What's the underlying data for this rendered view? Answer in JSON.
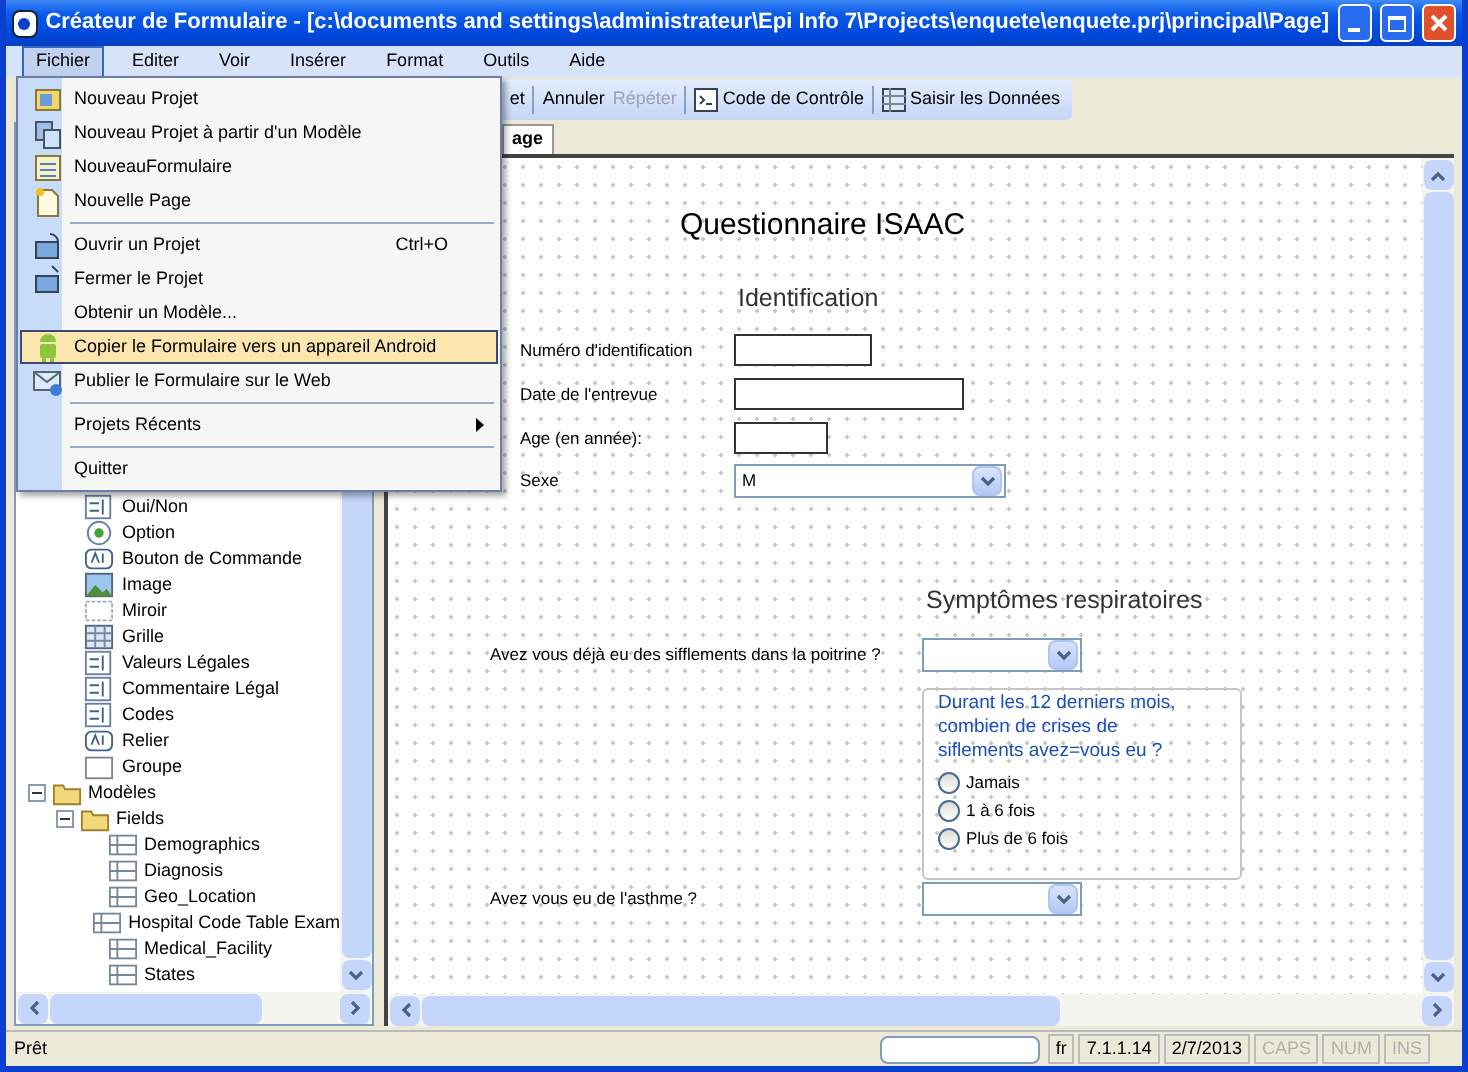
{
  "window": {
    "title": "Créateur de Formulaire - [c:\\documents and settings\\administrateur\\Epi Info 7\\Projects\\enquete\\enquete.prj\\principal\\Page]"
  },
  "menubar": [
    {
      "label": "Fichier",
      "selected": true
    },
    {
      "label": "Editer",
      "selected": false
    },
    {
      "label": "Voir",
      "selected": false
    },
    {
      "label": "Insérer",
      "selected": false
    },
    {
      "label": "Format",
      "selected": false
    },
    {
      "label": "Outils",
      "selected": false
    },
    {
      "label": "Aide",
      "selected": false
    }
  ],
  "toolbar": [
    {
      "label": "et",
      "kind": "text",
      "disabled": false
    },
    {
      "label": "Annuler",
      "kind": "text",
      "disabled": false
    },
    {
      "label": "Répéter",
      "kind": "text",
      "disabled": true
    },
    {
      "label": "Code de Contrôle",
      "kind": "code",
      "disabled": false
    },
    {
      "label": "Saisir les Données",
      "kind": "grid",
      "disabled": false
    }
  ],
  "file_menu": [
    {
      "kind": "item",
      "label": "Nouveau Projet",
      "selected": false
    },
    {
      "kind": "item",
      "label": "Nouveau Projet à partir d'un Modèle",
      "selected": false
    },
    {
      "kind": "item",
      "label": "NouveauFormulaire",
      "selected": false
    },
    {
      "kind": "item",
      "label": "Nouvelle Page",
      "selected": false
    },
    {
      "kind": "separator"
    },
    {
      "kind": "item",
      "label": "Ouvrir un Projet",
      "shortcut": "Ctrl+O",
      "selected": false
    },
    {
      "kind": "item",
      "label": "Fermer le Projet",
      "selected": false
    },
    {
      "kind": "item",
      "label": "Obtenir un Modèle...",
      "selected": false
    },
    {
      "kind": "item",
      "label": "Copier le Formulaire vers un appareil Android",
      "selected": true
    },
    {
      "kind": "item",
      "label": "Publier le Formulaire sur le Web",
      "selected": false
    },
    {
      "kind": "separator"
    },
    {
      "kind": "item",
      "label": "Projets Récents",
      "submenu": true,
      "selected": false
    },
    {
      "kind": "separator"
    },
    {
      "kind": "item",
      "label": "Quitter",
      "selected": false
    }
  ],
  "tree": {
    "field_types": [
      {
        "label": "Oui/Non"
      },
      {
        "label": "Option"
      },
      {
        "label": "Bouton de Commande"
      },
      {
        "label": "Image"
      },
      {
        "label": "Miroir"
      },
      {
        "label": "Grille"
      },
      {
        "label": "Valeurs Légales"
      },
      {
        "label": "Commentaire Légal"
      },
      {
        "label": "Codes"
      },
      {
        "label": "Relier"
      },
      {
        "label": "Groupe"
      }
    ],
    "nodes": [
      {
        "label": "Modèles",
        "expanded": true,
        "children": [
          {
            "label": "Fields",
            "expanded": true,
            "children": [
              {
                "label": "Demographics"
              },
              {
                "label": "Diagnosis"
              },
              {
                "label": "Geo_Location"
              },
              {
                "label": "Hospital Code Table Exam"
              },
              {
                "label": "Medical_Facility"
              },
              {
                "label": "States"
              }
            ]
          }
        ]
      }
    ]
  },
  "tabs": [
    {
      "label": "age",
      "selected": true
    }
  ],
  "form": {
    "title": "Questionnaire ISAAC",
    "sections": [
      {
        "kind": "heading",
        "label": "Identification"
      },
      {
        "kind": "text",
        "label": "Numéro d'identification"
      },
      {
        "kind": "text",
        "label": "Date de l'entrevue"
      },
      {
        "kind": "text",
        "label": "Age (en année):"
      },
      {
        "kind": "select",
        "label": "Sexe",
        "value": "M"
      },
      {
        "kind": "heading",
        "label": "Symptômes respiratoires"
      },
      {
        "kind": "select",
        "label": "Avez vous déjà eu des sifflements dans la poitrine ?"
      },
      {
        "kind": "options",
        "label": "Durant les 12 derniers mois, combien de crises de siflements avez=vous eu ?",
        "options": [
          {
            "label": "Jamais",
            "selected": false
          },
          {
            "label": "1 à 6 fois",
            "selected": false
          },
          {
            "label": "Plus de 6 fois",
            "selected": false
          }
        ]
      },
      {
        "kind": "select",
        "label": "Avez vous eu de l'asthme ?"
      }
    ]
  },
  "status_bar": {
    "message": "Prêt",
    "language": "fr",
    "version": "7.1.1.14",
    "date": "2/7/2013",
    "indicators": [
      {
        "label": "CAPS",
        "on": false
      },
      {
        "label": "NUM",
        "on": false
      },
      {
        "label": "INS",
        "on": false
      }
    ]
  }
}
